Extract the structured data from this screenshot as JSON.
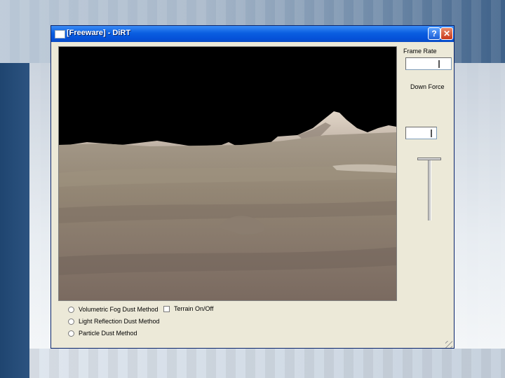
{
  "window": {
    "title": "[Freeware] - DiRT",
    "help_label": "?",
    "close_label": "✕"
  },
  "options": {
    "methods": [
      {
        "label": "Volumetric Fog Dust Method"
      },
      {
        "label": "Light Reflection Dust Method"
      },
      {
        "label": "Particle Dust Method"
      }
    ],
    "terrain_toggle": {
      "label": "Terrain On/Off",
      "checked": false
    }
  },
  "panel": {
    "frame_rate_label": "Frame Rate",
    "frame_rate_value": "",
    "down_force_label": "Down Force",
    "down_force_value": ""
  },
  "icons": {
    "app": "window-icon",
    "help": "help-icon",
    "close": "close-icon"
  },
  "colors": {
    "titlebar": "#0a5ee0",
    "sky": "#000000",
    "terrain": "#8f8270"
  }
}
